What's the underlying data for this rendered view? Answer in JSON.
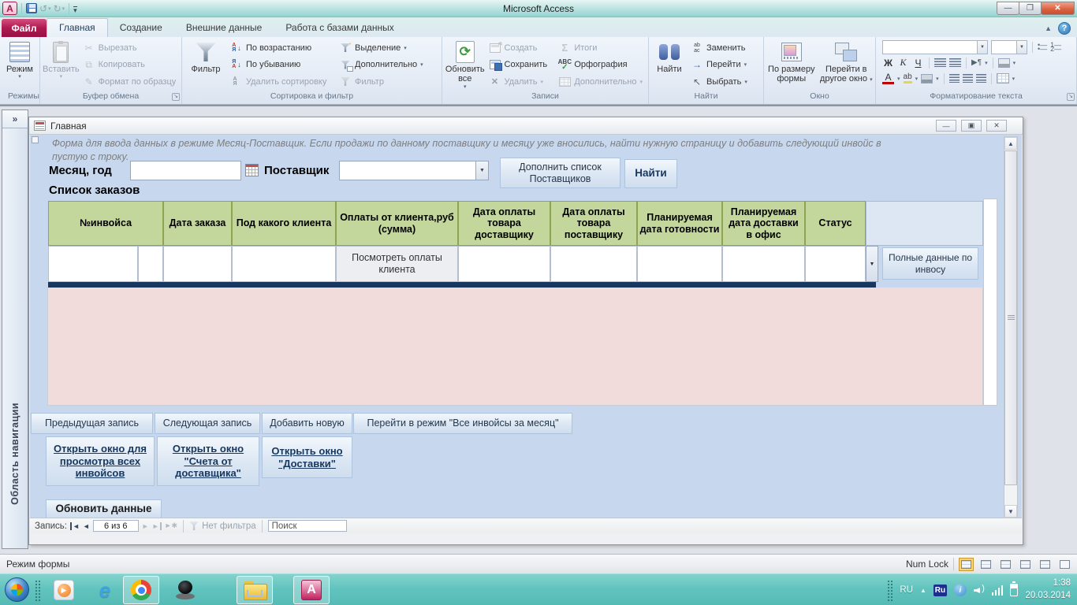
{
  "window": {
    "title": "Microsoft Access"
  },
  "qat": {
    "undo": "↺",
    "redo": "↻"
  },
  "tabs": {
    "file": "Файл",
    "items": [
      "Главная",
      "Создание",
      "Внешние данные",
      "Работа с базами данных"
    ]
  },
  "ribbon": {
    "groups": {
      "views": {
        "label": "Режимы",
        "big": "Режим"
      },
      "clipboard": {
        "label": "Буфер обмена",
        "big": "Вставить",
        "items": [
          "Вырезать",
          "Копировать",
          "Формат по образцу"
        ]
      },
      "sort": {
        "label": "Сортировка и фильтр",
        "big": "Фильтр",
        "col1": [
          "По возрастанию",
          "По убыванию",
          "Удалить сортировку"
        ],
        "col2": [
          "Выделение",
          "Дополнительно",
          "Фильтр"
        ]
      },
      "records": {
        "label": "Записи",
        "big": "Обновить все",
        "col1": [
          "Создать",
          "Сохранить",
          "Удалить"
        ],
        "col2": [
          "Итоги",
          "Орфография",
          "Дополнительно"
        ]
      },
      "find": {
        "label": "Найти",
        "big": "Найти",
        "col1": [
          "Заменить",
          "Перейти",
          "Выбрать"
        ]
      },
      "window": {
        "label": "Окно",
        "btn1": "По размеру формы",
        "btn2": "Перейти в другое окно"
      },
      "format": {
        "label": "Форматирование текста",
        "bold": "Ж",
        "italic": "К",
        "underline": "Ч",
        "fontcolor": "А",
        "highlight": "ab"
      }
    }
  },
  "navpane": {
    "expand": "»",
    "label": "Область навигации"
  },
  "form": {
    "title": "Главная",
    "description_lines": [
      "Форма для ввода данных в режиме Месяц-Поставщик. Если продажи по данному поставщику и месяцу уже вносились, найти нужную страницу и добавить следующий инвойс в",
      "пустую с троку."
    ],
    "month_label": "Месяц, год",
    "supplier_label": "Поставщик",
    "add_suppliers_button": "Дополнить список Поставщиков",
    "find_button": "Найти",
    "orders_label": "Список заказов",
    "table_headers": [
      "№инвойса",
      "Дата заказа",
      "Под какого клиента",
      "Оплаты от клиента,руб (сумма)",
      "Дата оплаты товара доставщику",
      "Дата оплаты товара поставщику",
      "Планируемая дата готовности",
      "Планируемая дата доставки в офис",
      "Статус"
    ],
    "row_button": "Посмотреть оплаты клиента",
    "full_data_button": "Полные данные по инвосу",
    "nav_buttons": [
      "Предыдущая запись",
      "Следующая запись",
      "Добавить новую",
      "Перейти в режим \"Все инвойсы за месяц\""
    ],
    "link_buttons": [
      "Открыть окно для просмотра всех инвойсов",
      "Открыть окно \"Счета от доставщика\"",
      "Открыть окно \"Доставки\""
    ],
    "refresh_button": "Обновить данные",
    "record_nav": {
      "label": "Запись:",
      "position": "6 из 6",
      "no_filter": "Нет фильтра",
      "search": "Поиск"
    }
  },
  "statusbar": {
    "mode": "Режим формы",
    "numlock": "Num Lock"
  },
  "taskbar": {
    "tray": {
      "lang": "RU",
      "kb_badge": "Ru",
      "time": "1:38",
      "date": "20.03.2014"
    }
  },
  "icons": {
    "app": "access-logo",
    "save": "floppy-disk",
    "undo": "undo-arrow",
    "redo": "redo-arrow",
    "filter": "funnel",
    "refresh": "green-circular-arrows",
    "find": "binoculars",
    "calendar": "calendar-grid",
    "dropdown": "▾",
    "scissors": "✂",
    "copy": "⧉",
    "format_painter": "✎",
    "sigma": "Σ",
    "goto": "→",
    "select": "↖"
  }
}
